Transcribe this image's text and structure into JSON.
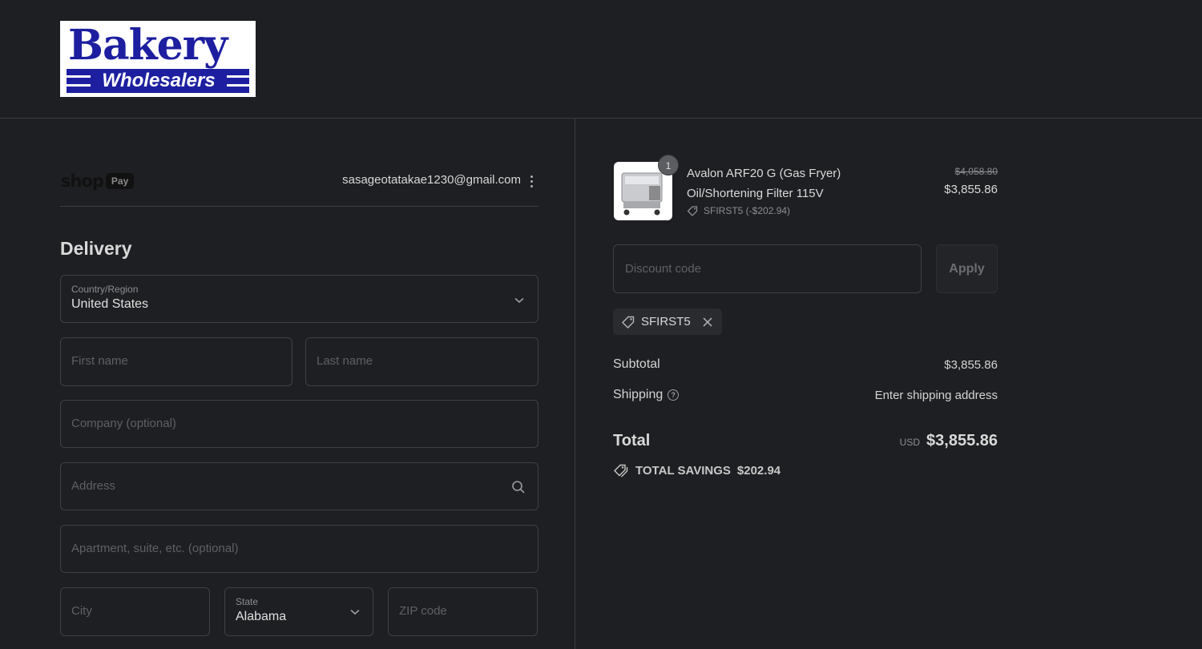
{
  "brand": {
    "logo_top": "Bakery",
    "logo_bottom": "Wholesalers"
  },
  "account": {
    "shop_pay_word": "shop",
    "shop_pay_pill": "Pay",
    "email": "sasageotatakae1230@gmail.com"
  },
  "delivery": {
    "heading": "Delivery",
    "country_label": "Country/Region",
    "country_value": "United States",
    "first_name_placeholder": "First name",
    "last_name_placeholder": "Last name",
    "company_placeholder": "Company (optional)",
    "address_placeholder": "Address",
    "apartment_placeholder": "Apartment, suite, etc. (optional)",
    "city_placeholder": "City",
    "state_label": "State",
    "state_value": "Alabama",
    "zip_placeholder": "ZIP code"
  },
  "order": {
    "quantity": "1",
    "product_title": "Avalon ARF20 G (Gas Fryer) Oil/Shortening Filter 115V",
    "product_discount": "SFIRST5 (-$202.94)",
    "price_original": "$4,058.80",
    "price_final": "$3,855.86",
    "discount_placeholder": "Discount code",
    "apply_label": "Apply",
    "applied_code": "SFIRST5",
    "subtotal_label": "Subtotal",
    "subtotal_value": "$3,855.86",
    "shipping_label": "Shipping",
    "shipping_value": "Enter shipping address",
    "total_label": "Total",
    "total_currency": "USD",
    "total_value": "$3,855.86",
    "savings_label": "TOTAL SAVINGS",
    "savings_value": "$202.94"
  },
  "colors": {
    "background": "#1e1f22",
    "border": "#3f4044",
    "logo_blue": "#1d1fa0"
  }
}
